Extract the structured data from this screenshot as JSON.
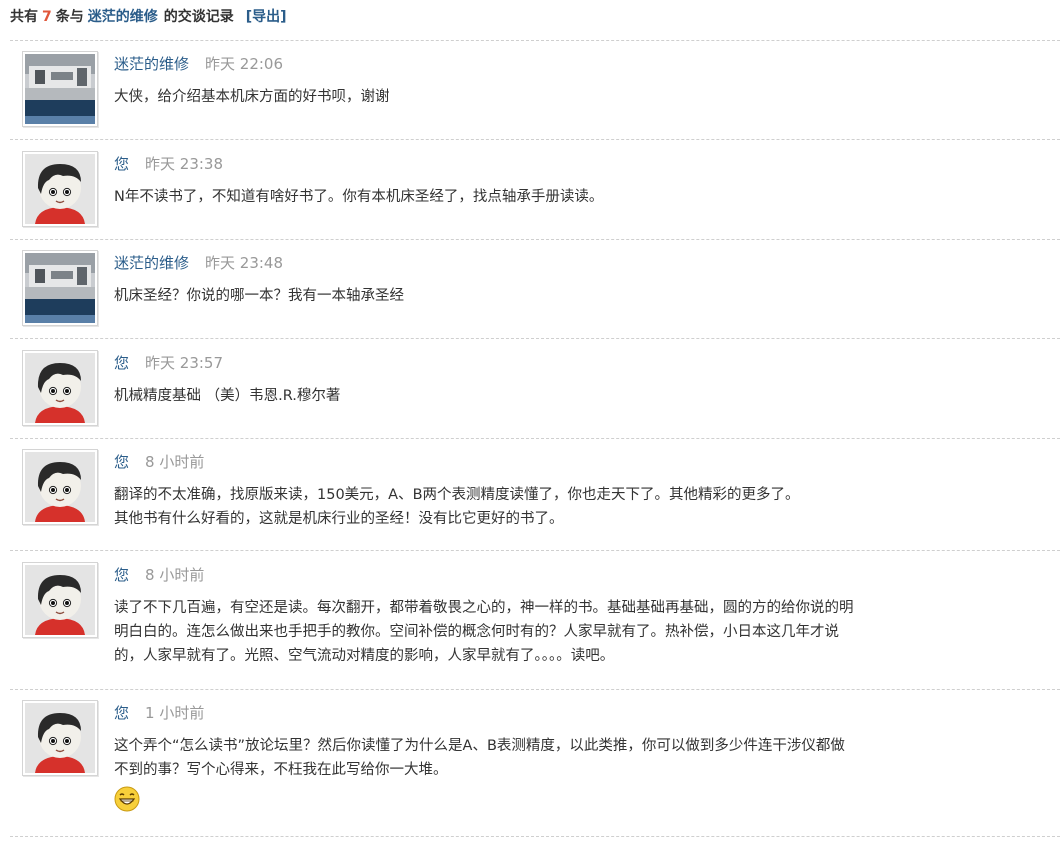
{
  "summary": {
    "prefix": "共有",
    "count": "7",
    "mid": "条与",
    "peer": "迷茫的维修",
    "suffix": "的交谈记录",
    "export": "[导出]"
  },
  "messages": [
    {
      "author": "迷茫的维修",
      "time": "昨天 22:06",
      "avatar": "machine-photo",
      "lines": [
        "大侠，给介绍基本机床方面的好书呗，谢谢"
      ]
    },
    {
      "author": "您",
      "time": "昨天 23:38",
      "avatar": "cartoon-boy",
      "lines": [
        "N年不读书了，不知道有啥好书了。你有本机床圣经了，找点轴承手册读读。"
      ]
    },
    {
      "author": "迷茫的维修",
      "time": "昨天 23:48",
      "avatar": "machine-photo",
      "lines": [
        "机床圣经？你说的哪一本？我有一本轴承圣经"
      ]
    },
    {
      "author": "您",
      "time": "昨天 23:57",
      "avatar": "cartoon-boy",
      "lines": [
        "机械精度基础 （美）韦恩.R.穆尔著"
      ]
    },
    {
      "author": "您",
      "time": "8 小时前",
      "avatar": "cartoon-boy",
      "lines": [
        "翻译的不太准确，找原版来读，150美元，A、B两个表测精度读懂了，你也走天下了。其他精彩的更多了。",
        "其他书有什么好看的，这就是机床行业的圣经！没有比它更好的书了。"
      ]
    },
    {
      "author": "您",
      "time": "8 小时前",
      "avatar": "cartoon-boy",
      "lines": [
        "读了不下几百遍，有空还是读。每次翻开，都带着敬畏之心的，神一样的书。基础基础再基础，圆的方的给你说的明",
        "明白白的。连怎么做出来也手把手的教你。空间补偿的概念何时有的？人家早就有了。热补偿，小日本这几年才说",
        "的，人家早就有了。光照、空气流动对精度的影响，人家早就有了。。。。读吧。"
      ]
    },
    {
      "author": "您",
      "time": "1 小时前",
      "avatar": "cartoon-boy",
      "lines": [
        "这个弄个“怎么读书”放论坛里？然后你读懂了为什么是A、B表测精度，以此类推，你可以做到多少件连干涉仪都做",
        "不到的事？写个心得来，不枉我在此写给你一大堆。"
      ],
      "emoji": "grin-emoji"
    }
  ]
}
